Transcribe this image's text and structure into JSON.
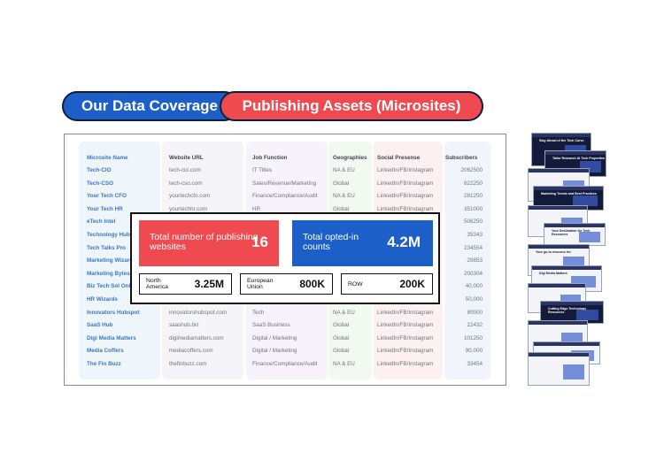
{
  "header": {
    "pill_left": "Our Data Coverage",
    "pill_right": "Publishing  Assets (Microsites)"
  },
  "table": {
    "columns": [
      "Microsite Name",
      "Website URL",
      "Job Function",
      "Geographies",
      "Social Presense",
      "Subscribers"
    ],
    "rows": [
      [
        "Tech-CIO",
        "tech-cio.com",
        "IT Titles",
        "NA & EU",
        "LinkedIn/FB/Instagram",
        "2062500"
      ],
      [
        "Tech-CSO",
        "tech-cso.com",
        "Sales/Revenue/Marketing",
        "Global",
        "LinkedIn/FB/Instagram",
        "822250"
      ],
      [
        "Your Tech CFO",
        "yourtechcfo.com",
        "Finance/Compliance/Audit",
        "NA & EU",
        "LinkedIn/FB/Instagram",
        "281250"
      ],
      [
        "Your Tech HR",
        "yourtechhr.com",
        "HR",
        "Global",
        "LinkedIn/FB/Instagram",
        "351000"
      ],
      [
        "eTech Intel",
        "",
        "",
        "",
        "",
        "506250"
      ],
      [
        "Technology Hubsp",
        "",
        "",
        "",
        "",
        "35343"
      ],
      [
        "Tech Talks Pro",
        "",
        "",
        "",
        "",
        "234554"
      ],
      [
        "Marketing Wizard",
        "",
        "",
        "",
        "",
        "29853"
      ],
      [
        "Marketing Bytes",
        "",
        "",
        "",
        "",
        "200304"
      ],
      [
        "Biz Tech Sol Onlin",
        "",
        "",
        "",
        "",
        "40,000"
      ],
      [
        "HR Wizards",
        "",
        "",
        "",
        "",
        "50,000"
      ],
      [
        "Innovators Hubspot",
        "innovatorshubspot.com",
        "Tech",
        "NA & EU",
        "LinkedIn/FB/Instagram",
        "80000"
      ],
      [
        "SaaS Hub",
        "saashub.biz",
        "SaaS Business",
        "Global",
        "LinkedIn/FB/Instagram",
        "22432"
      ],
      [
        "Digi Media Matters",
        "digimediamatters.com",
        "Digital / Marketing",
        "Global",
        "LinkedIn/FB/Instagram",
        "101250"
      ],
      [
        "Media Coffers",
        "mediacoffers.com",
        "Digital / Marketing",
        "Global",
        "LinkedIn/FB/Instagram",
        "90,000"
      ],
      [
        "The Fin Buzz",
        "thefinbuzz.com",
        "Finance/Compliance/Audit",
        "NA & EU",
        "LinkedIn/FB/Instagram",
        "33454"
      ]
    ]
  },
  "stats": {
    "websites_label": "Total number of publishing websites",
    "websites_value": "16",
    "optin_label": "Total opted-in counts",
    "optin_value": "4.2M",
    "na_label": "North America",
    "na_value": "3.25M",
    "eu_label": "European Union",
    "eu_value": "800K",
    "row_label": "ROW",
    "row_value": "200K"
  },
  "thumbnails": [
    {
      "title": "Stay Ahead of the Tech Curve",
      "theme": "dark"
    },
    {
      "title": "Tailor Research AI Tech Properties",
      "theme": "dark"
    },
    {
      "title": "",
      "theme": "light"
    },
    {
      "title": "Marketing Trends and Best Practices",
      "theme": "dark"
    },
    {
      "title": "",
      "theme": "light"
    },
    {
      "title": "Your Destination for Tech Resources",
      "theme": "light"
    },
    {
      "title": "Your go-to resource for",
      "theme": "light"
    },
    {
      "title": "Digi Media Matters",
      "theme": "light"
    },
    {
      "title": "",
      "theme": "light"
    },
    {
      "title": "Cutting Edge Technology Resources",
      "theme": "dark"
    },
    {
      "title": "",
      "theme": "light"
    },
    {
      "title": "",
      "theme": "light"
    },
    {
      "title": "",
      "theme": "light"
    }
  ],
  "colors": {
    "accent_blue": "#1d5fc9",
    "accent_red": "#ef4a4f",
    "link_blue": "#3b78c4"
  }
}
